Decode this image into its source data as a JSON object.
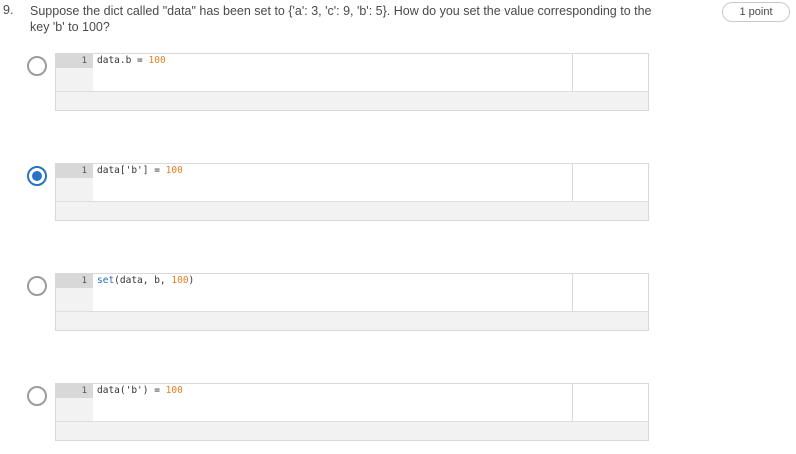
{
  "question": {
    "number": "9.",
    "text": "Suppose the dict called \"data\" has been set to {'a': 3, 'c': 9, 'b': 5}. How do you set the value corresponding to the key 'b' to 100?",
    "points": "1 point"
  },
  "options": [
    {
      "line": "1",
      "selected": false,
      "tokens": [
        {
          "t": "data.b ",
          "c": "plain"
        },
        {
          "t": "=",
          "c": "plain"
        },
        {
          "t": " ",
          "c": "plain"
        },
        {
          "t": "100",
          "c": "num"
        }
      ]
    },
    {
      "line": "1",
      "selected": true,
      "tokens": [
        {
          "t": "data[",
          "c": "plain"
        },
        {
          "t": "'b'",
          "c": "str"
        },
        {
          "t": "] = ",
          "c": "plain"
        },
        {
          "t": "100",
          "c": "num"
        }
      ]
    },
    {
      "line": "1",
      "selected": false,
      "tokens": [
        {
          "t": "set",
          "c": "fn"
        },
        {
          "t": "(data, b, ",
          "c": "plain"
        },
        {
          "t": "100",
          "c": "num"
        },
        {
          "t": ")",
          "c": "plain"
        }
      ]
    },
    {
      "line": "1",
      "selected": false,
      "tokens": [
        {
          "t": "data(",
          "c": "plain"
        },
        {
          "t": "'b'",
          "c": "str"
        },
        {
          "t": ") = ",
          "c": "plain"
        },
        {
          "t": "100",
          "c": "num"
        }
      ]
    }
  ],
  "colors": {
    "accent": "#2673c7",
    "number": "#e67e22",
    "function": "#2b6bb5"
  }
}
